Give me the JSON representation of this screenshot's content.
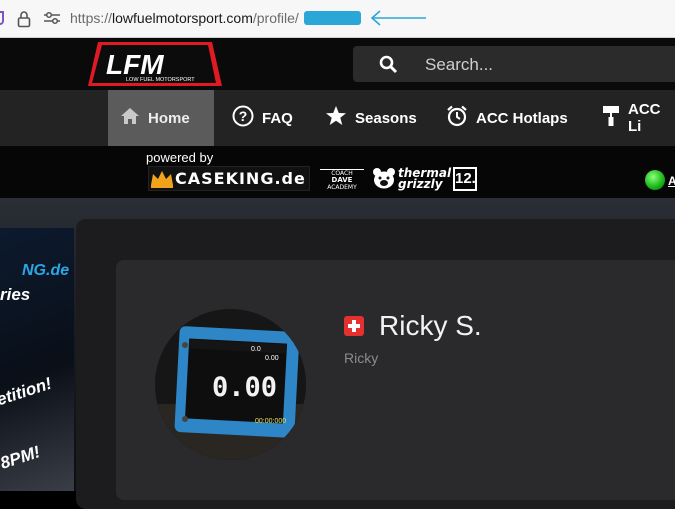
{
  "browser": {
    "url_prefix": "https://",
    "url_domain": "lowfuelmotorsport.com",
    "url_path": "/profile/"
  },
  "header": {
    "logo_text": "LFM",
    "logo_subtitle": "LOW FUEL MOTORSPORT",
    "search_placeholder": "Search..."
  },
  "nav": {
    "items": [
      {
        "label": "Home",
        "icon": "home-icon",
        "active": true
      },
      {
        "label": "FAQ",
        "icon": "question-circle-icon"
      },
      {
        "label": "Seasons",
        "icon": "star-icon"
      },
      {
        "label": "ACC Hotlaps",
        "icon": "alarm-clock-icon"
      },
      {
        "label": "ACC Li",
        "icon": "paint-roller-icon"
      }
    ]
  },
  "sponsors": {
    "powered_by": "powered by",
    "caseking": "CASEKING.de",
    "coach_line1": "COACH",
    "coach_line2": "DAVE",
    "coach_line3": "ACADEMY",
    "thermal_line1": "thermal",
    "thermal_line2": "grizzly",
    "twelve": "12.",
    "online_label": "A"
  },
  "banner": {
    "line1": "NG.de",
    "line2": "ries",
    "line3": "etition!",
    "line4": "8PM!"
  },
  "profile": {
    "name": "Ricky S.",
    "first_name": "Ricky",
    "country_flag": "switzerland",
    "display_speed": "0.00",
    "display_small1": "0.0",
    "display_small2": "0.00",
    "display_time": "00:00:000"
  },
  "colors": {
    "accent_blue": "#2aa7d6",
    "online_green": "#16b316",
    "flag_red": "#e53030"
  }
}
